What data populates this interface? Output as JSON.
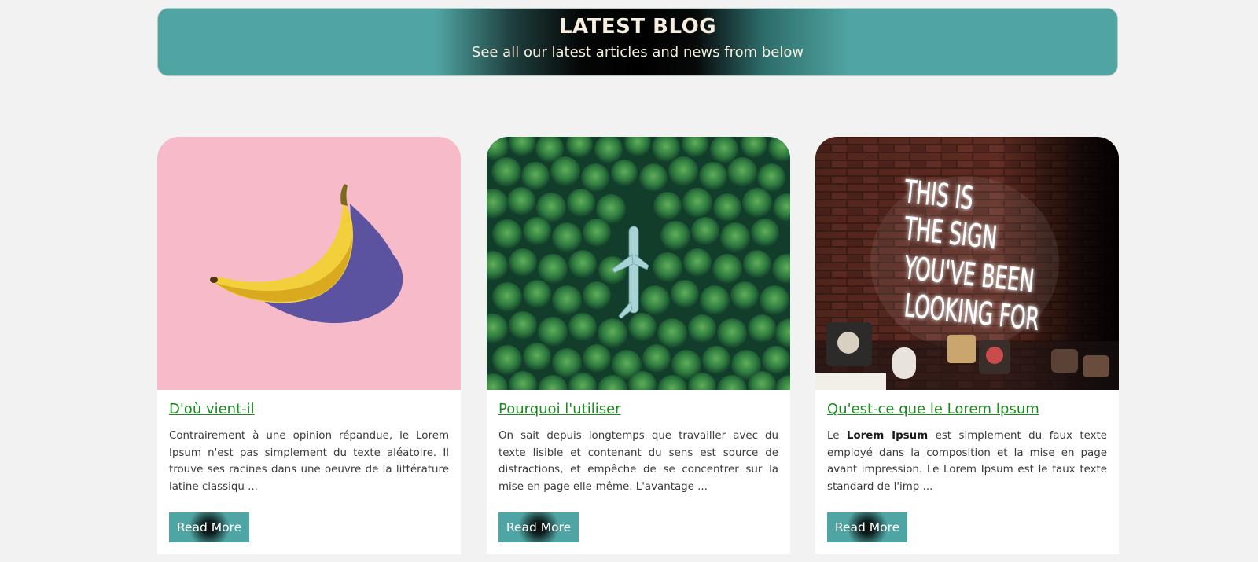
{
  "header": {
    "title": "LATEST BLOG",
    "subtitle": "See all our latest articles and news from below"
  },
  "cards": [
    {
      "image": "banana-on-pink-image",
      "title": "D'où vient-il",
      "text": "Contrairement à une opinion répandue, le Lorem Ipsum n'est pas simplement du texte aléatoire. Il trouve ses racines dans une oeuvre de la littérature latine classiqu ...",
      "button": "Read More"
    },
    {
      "image": "airplane-in-forest-image",
      "title": "Pourquoi l'utiliser",
      "text": "On sait depuis longtemps que travailler avec du texte lisible et contenant du sens est source de distractions, et empêche de se concentrer sur la mise en page elle-même. L'avantage ...",
      "button": "Read More"
    },
    {
      "image": "neon-sign-brick-wall-image",
      "image_text": [
        "THIS IS",
        "THE SIGN",
        "YOU'VE BEEN",
        "LOOKING FOR"
      ],
      "title": "Qu'est-ce que le Lorem Ipsum",
      "text_prefix": "Le ",
      "text_bold": "Lorem Ipsum",
      "text_rest": " est simplement du faux texte employé dans la composition et la mise en page avant impression. Le Lorem Ipsum est le faux texte standard de l'imp ...",
      "button": "Read More"
    }
  ],
  "colors": {
    "accent": "#50a4a2",
    "link": "#1a8a1f",
    "background": "#f1f2f1",
    "banana_bg": "#f7bac8"
  }
}
